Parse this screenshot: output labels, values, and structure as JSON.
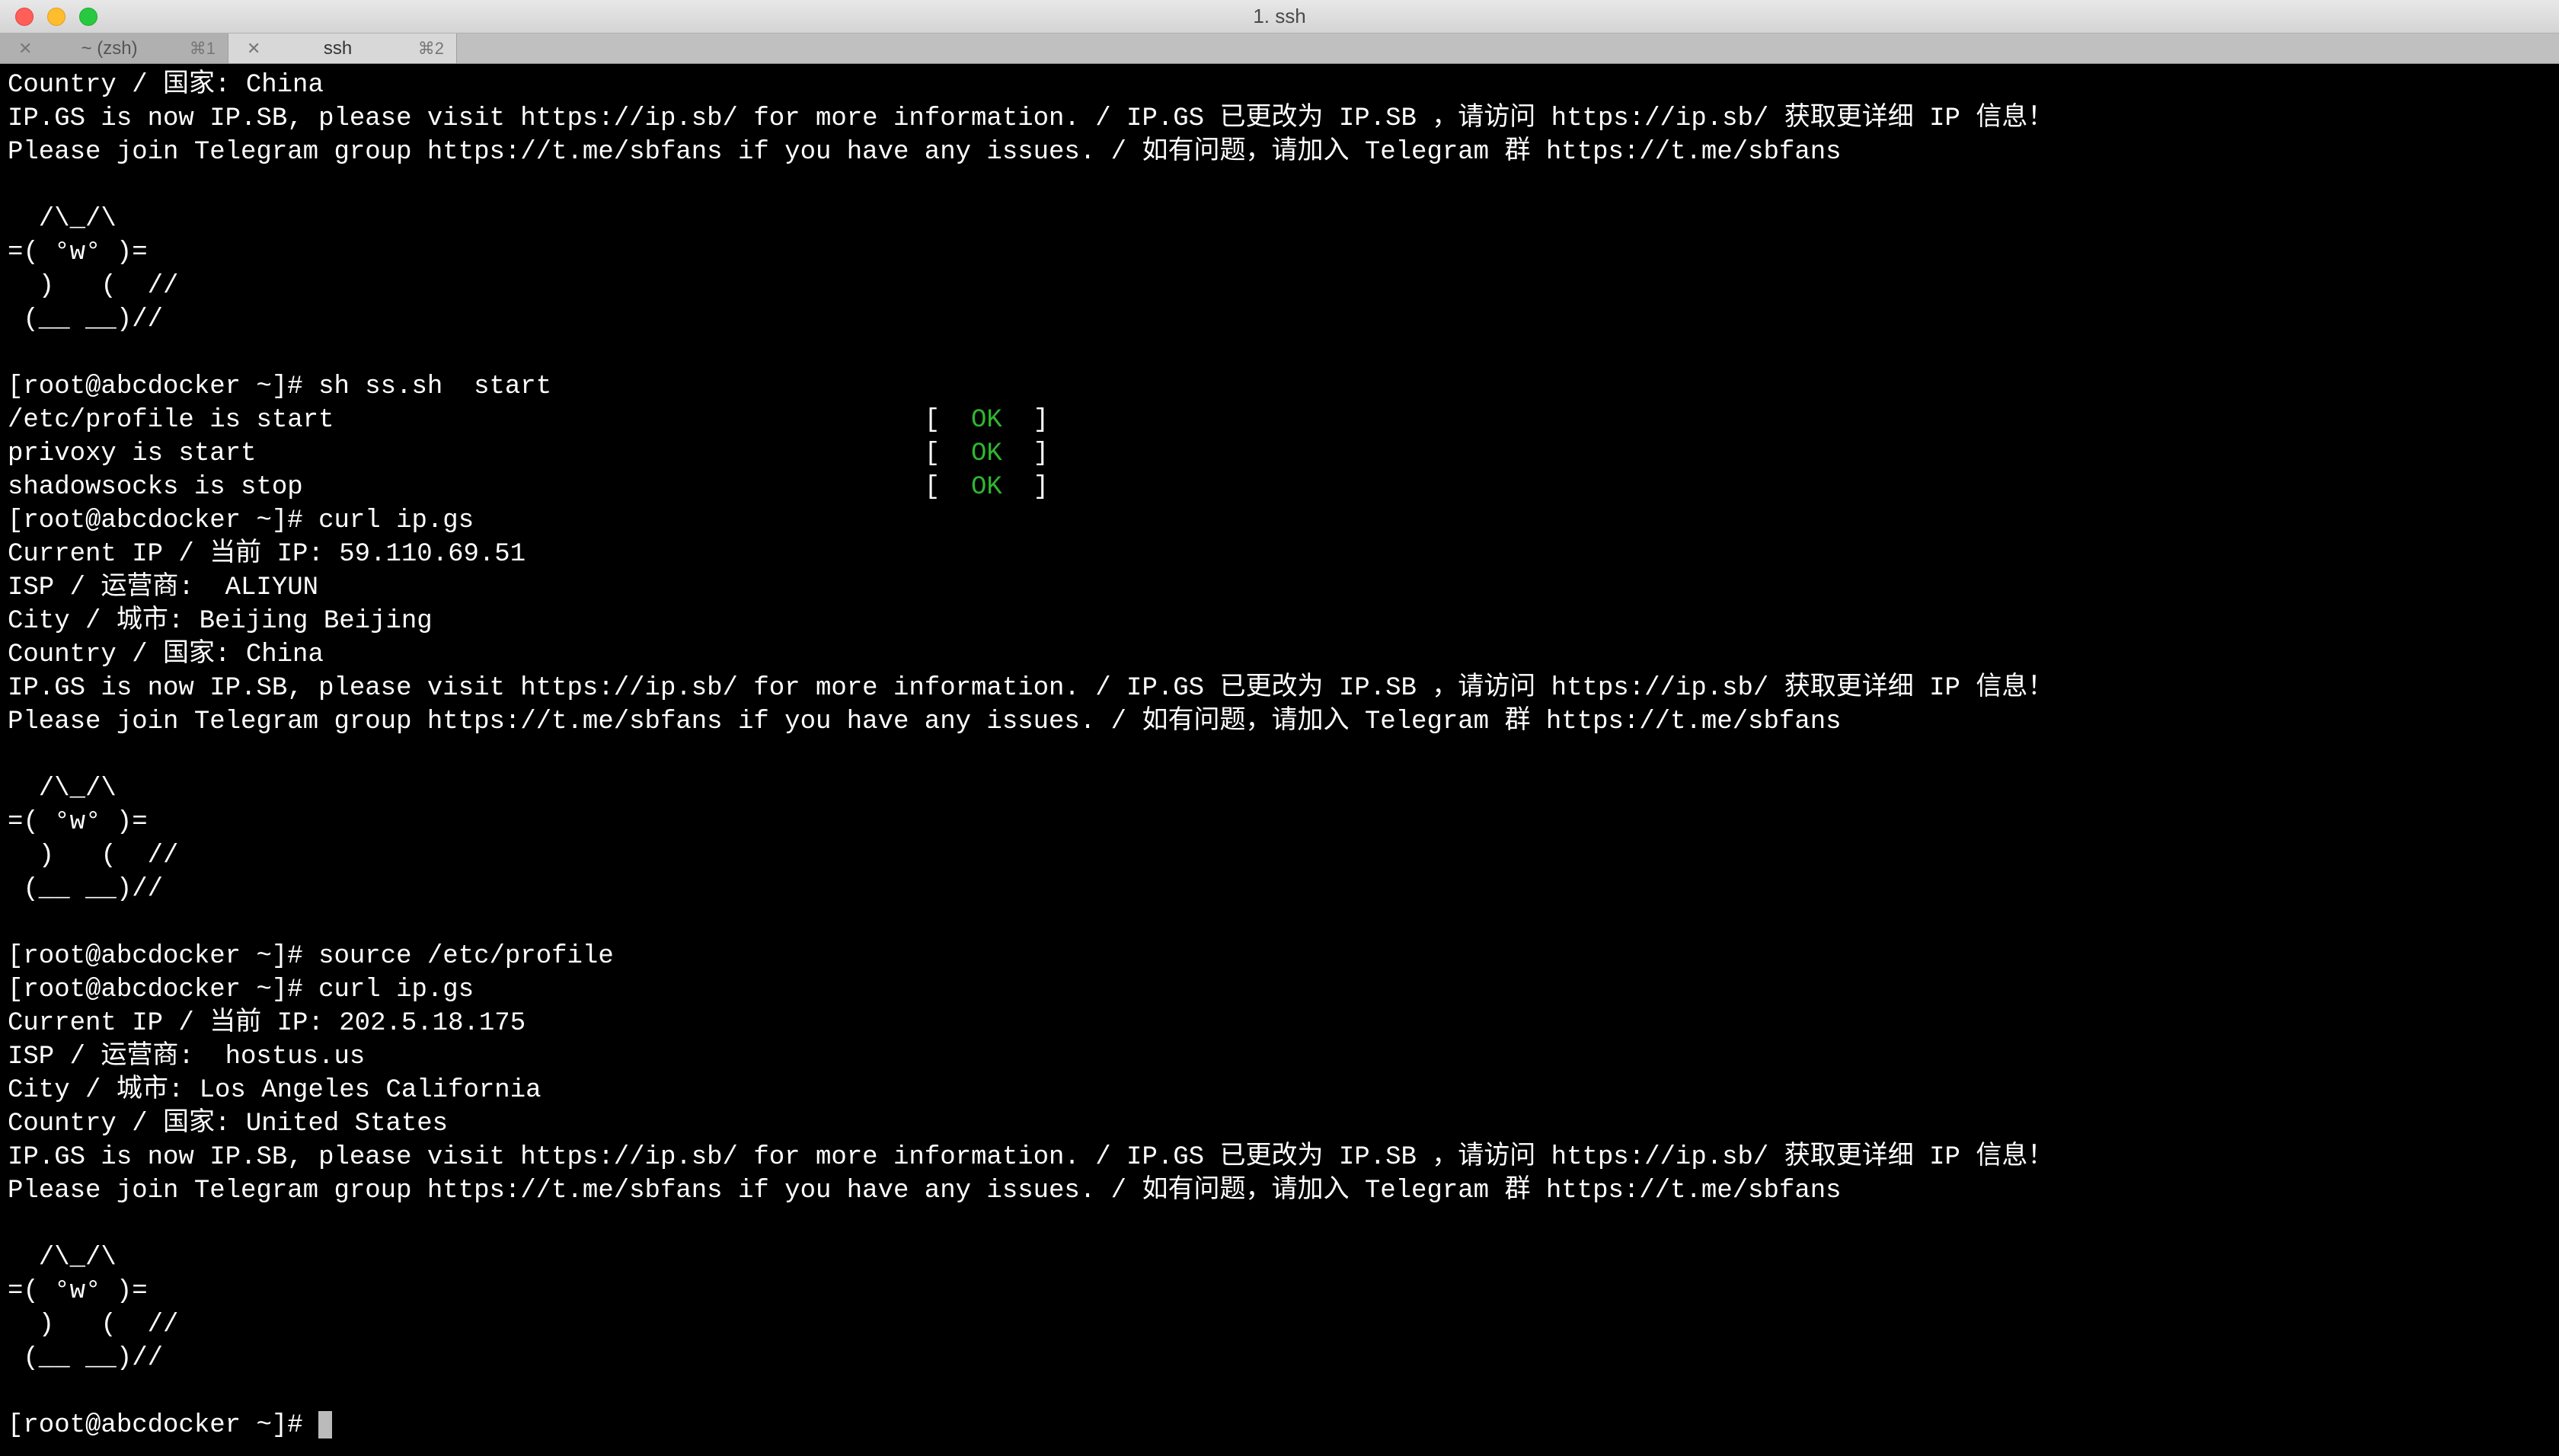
{
  "window": {
    "title": "1. ssh"
  },
  "tabs": [
    {
      "label": "~ (zsh)",
      "shortcut": "⌘1",
      "active": false
    },
    {
      "label": "ssh",
      "shortcut": "⌘2",
      "active": true
    }
  ],
  "terminal": {
    "lines": [
      "Country / 国家: China",
      "IP.GS is now IP.SB, please visit https://ip.sb/ for more information. / IP.GS 已更改为 IP.SB ，请访问 https://ip.sb/ 获取更详细 IP 信息！",
      "Please join Telegram group https://t.me/sbfans if you have any issues. / 如有问题，请加入 Telegram 群 https://t.me/sbfans",
      "",
      "  /\\_/\\",
      "=( °w° )=",
      "  )   (  //",
      " (__ __)//",
      "",
      "[root@abcdocker ~]# sh ss.sh  start"
    ],
    "status_lines": [
      {
        "left": "/etc/profile is start",
        "status": "OK"
      },
      {
        "left": "privoxy is start",
        "status": "OK"
      },
      {
        "left": "shadowsocks is stop",
        "status": "OK"
      }
    ],
    "lines2": [
      "[root@abcdocker ~]# curl ip.gs",
      "Current IP / 当前 IP: 59.110.69.51",
      "ISP / 运营商:  ALIYUN",
      "City / 城市: Beijing Beijing",
      "Country / 国家: China",
      "IP.GS is now IP.SB, please visit https://ip.sb/ for more information. / IP.GS 已更改为 IP.SB ，请访问 https://ip.sb/ 获取更详细 IP 信息！",
      "Please join Telegram group https://t.me/sbfans if you have any issues. / 如有问题，请加入 Telegram 群 https://t.me/sbfans",
      "",
      "  /\\_/\\",
      "=( °w° )=",
      "  )   (  //",
      " (__ __)//",
      "",
      "[root@abcdocker ~]# source /etc/profile",
      "[root@abcdocker ~]# curl ip.gs",
      "Current IP / 当前 IP: 202.5.18.175",
      "ISP / 运营商:  hostus.us",
      "City / 城市: Los Angeles California",
      "Country / 国家: United States",
      "IP.GS is now IP.SB, please visit https://ip.sb/ for more information. / IP.GS 已更改为 IP.SB ，请访问 https://ip.sb/ 获取更详细 IP 信息！",
      "Please join Telegram group https://t.me/sbfans if you have any issues. / 如有问题，请加入 Telegram 群 https://t.me/sbfans",
      "",
      "  /\\_/\\",
      "=( °w° )=",
      "  )   (  //",
      " (__ __)//",
      ""
    ],
    "prompt": "[root@abcdocker ~]# ",
    "status_bracket_left": "[  ",
    "status_bracket_right": "  ]"
  }
}
